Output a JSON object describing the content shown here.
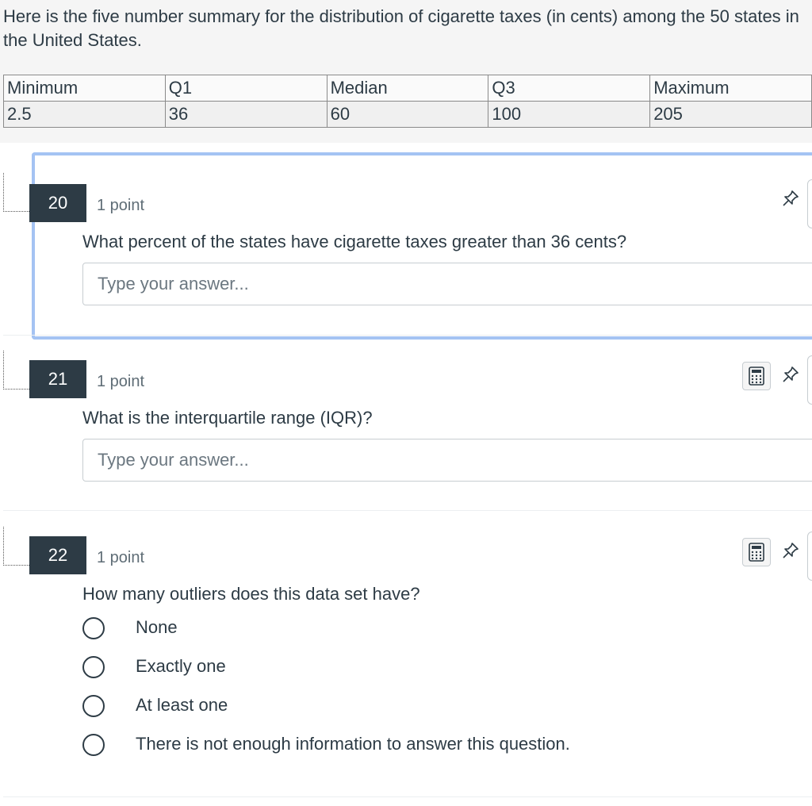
{
  "stimulus": {
    "text": "Here is the five number summary for the distribution of cigarette taxes (in cents) among the 50 states in the United States.",
    "table": {
      "headers": [
        "Minimum",
        "Q1",
        "Median",
        "Q3",
        "Maximum"
      ],
      "values": [
        "2.5",
        "36",
        "60",
        "100",
        "205"
      ]
    }
  },
  "questions": [
    {
      "number": "20",
      "points": "1 point",
      "text": "What percent of the states have cigarette taxes greater than 36 cents?",
      "placeholder": "Type your answer...",
      "icons": [
        "pin-icon"
      ]
    },
    {
      "number": "21",
      "points": "1 point",
      "text": "What is the interquartile range (IQR)?",
      "placeholder": "Type your answer...",
      "icons": [
        "calculator-icon",
        "pin-icon"
      ]
    },
    {
      "number": "22",
      "points": "1 point",
      "text": "How many outliers does this data set have?",
      "options": [
        "None",
        "Exactly one",
        "At least one",
        "There is not enough information to answer this question."
      ],
      "icons": [
        "calculator-icon",
        "pin-icon"
      ]
    }
  ],
  "colors": {
    "question_badge": "#2d3b45",
    "active_border": "#a4c3f3",
    "stimulus_bg": "#f5f5f5"
  }
}
